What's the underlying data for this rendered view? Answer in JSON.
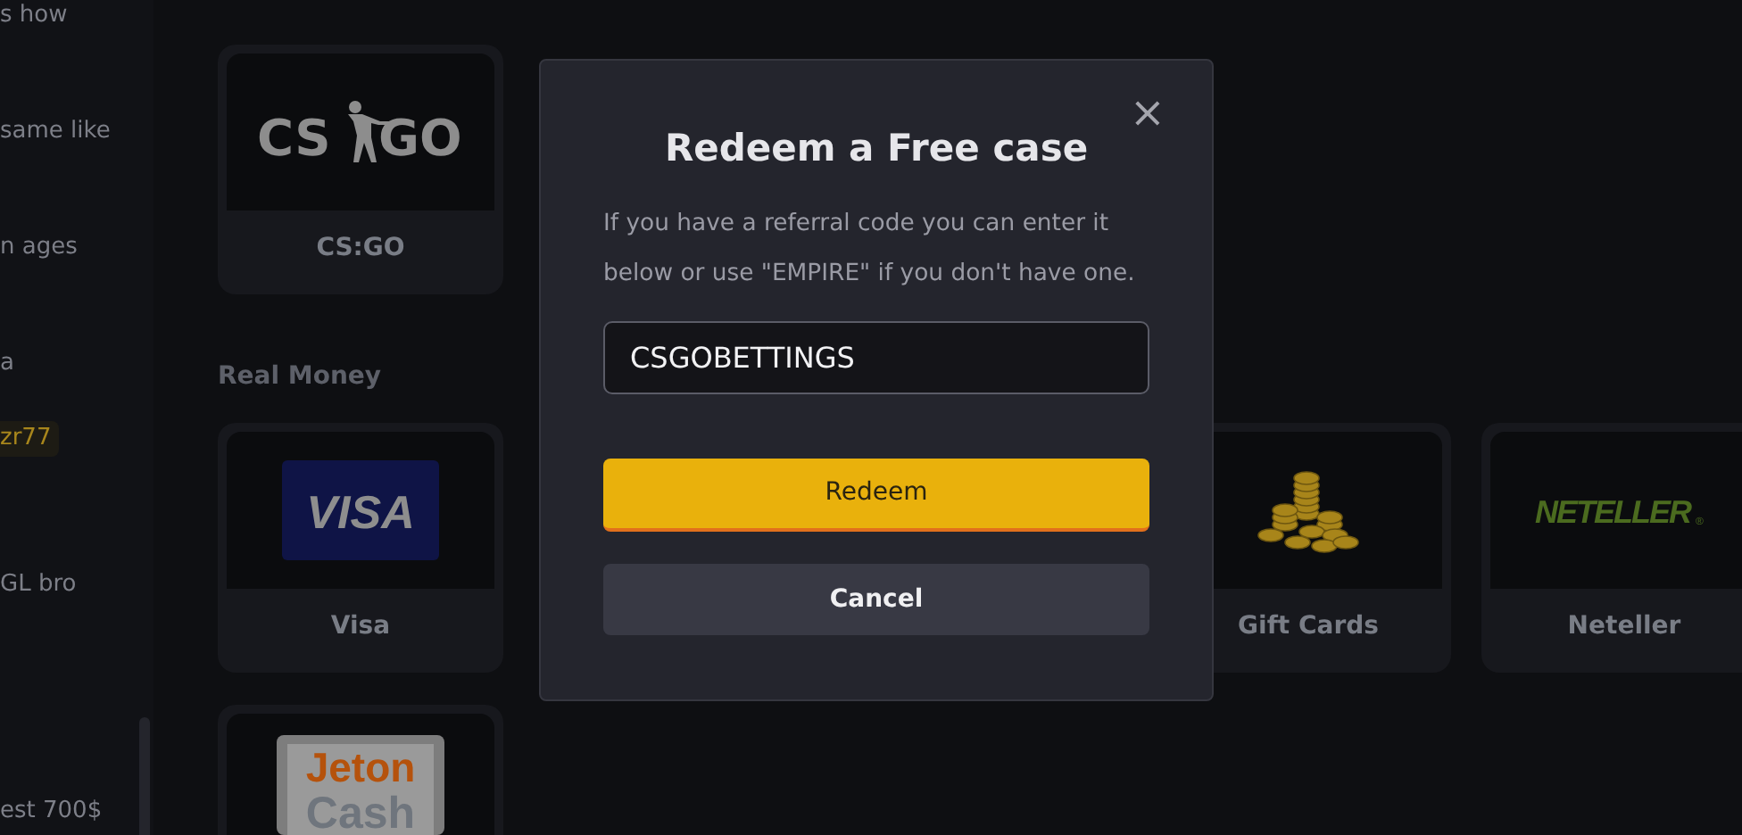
{
  "sidebar": {
    "messages": [
      {
        "kind": "text",
        "text": "s how"
      },
      {
        "kind": "text",
        "text": "same like"
      },
      {
        "kind": "text",
        "text": "n ages"
      },
      {
        "kind": "text",
        "text": "a"
      },
      {
        "kind": "tag",
        "text": "zr77"
      },
      {
        "kind": "text",
        "text": "GL bro"
      },
      {
        "kind": "text",
        "text": "est 700$"
      }
    ]
  },
  "sections": [
    {
      "cards": [
        {
          "kind": "csgo",
          "logo_text": [
            "CS",
            "GO"
          ],
          "label": "CS:GO"
        }
      ]
    },
    {
      "title": "Real Money",
      "cards": [
        {
          "kind": "visa",
          "logo_text": [
            "VISA"
          ],
          "label": "Visa"
        },
        {
          "kind": "hidden"
        },
        {
          "kind": "hidden"
        },
        {
          "kind": "coins",
          "label": "Gift Cards"
        },
        {
          "kind": "neteller",
          "logo_text": [
            "NETELLER",
            "®"
          ],
          "label": "Neteller"
        }
      ]
    },
    {
      "cards": [
        {
          "kind": "jeton",
          "logo_text": [
            "Jeton",
            "Cash"
          ]
        }
      ]
    }
  ],
  "modal": {
    "title": "Redeem a Free case",
    "close": "×",
    "text": "If you have a referral code you can enter it below or use \"EMPIRE\" if you don't have one.",
    "code_field": {
      "value": "CSGOBETTINGS"
    },
    "buttons": [
      {
        "kind": "primary",
        "label": "Redeem"
      },
      {
        "kind": "secondary",
        "label": "Cancel"
      }
    ]
  }
}
